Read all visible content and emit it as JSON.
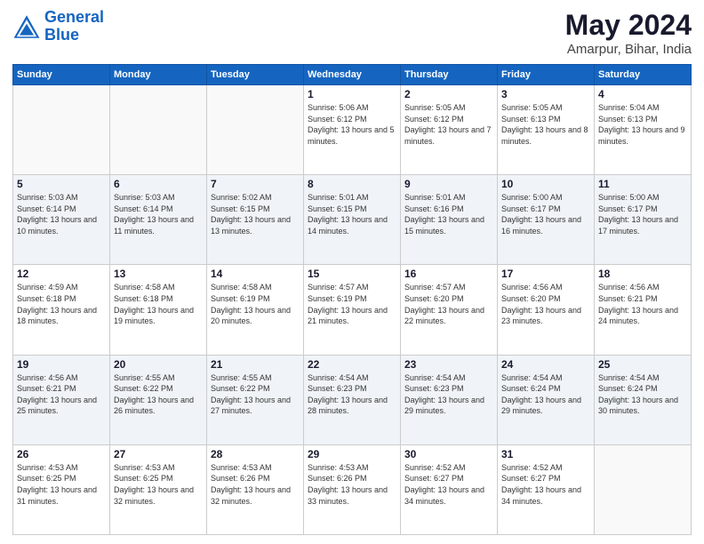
{
  "logo": {
    "line1": "General",
    "line2": "Blue"
  },
  "title": "May 2024",
  "subtitle": "Amarpur, Bihar, India",
  "weekdays": [
    "Sunday",
    "Monday",
    "Tuesday",
    "Wednesday",
    "Thursday",
    "Friday",
    "Saturday"
  ],
  "weeks": [
    [
      {
        "day": "",
        "info": ""
      },
      {
        "day": "",
        "info": ""
      },
      {
        "day": "",
        "info": ""
      },
      {
        "day": "1",
        "info": "Sunrise: 5:06 AM\nSunset: 6:12 PM\nDaylight: 13 hours\nand 5 minutes."
      },
      {
        "day": "2",
        "info": "Sunrise: 5:05 AM\nSunset: 6:12 PM\nDaylight: 13 hours\nand 7 minutes."
      },
      {
        "day": "3",
        "info": "Sunrise: 5:05 AM\nSunset: 6:13 PM\nDaylight: 13 hours\nand 8 minutes."
      },
      {
        "day": "4",
        "info": "Sunrise: 5:04 AM\nSunset: 6:13 PM\nDaylight: 13 hours\nand 9 minutes."
      }
    ],
    [
      {
        "day": "5",
        "info": "Sunrise: 5:03 AM\nSunset: 6:14 PM\nDaylight: 13 hours\nand 10 minutes."
      },
      {
        "day": "6",
        "info": "Sunrise: 5:03 AM\nSunset: 6:14 PM\nDaylight: 13 hours\nand 11 minutes."
      },
      {
        "day": "7",
        "info": "Sunrise: 5:02 AM\nSunset: 6:15 PM\nDaylight: 13 hours\nand 13 minutes."
      },
      {
        "day": "8",
        "info": "Sunrise: 5:01 AM\nSunset: 6:15 PM\nDaylight: 13 hours\nand 14 minutes."
      },
      {
        "day": "9",
        "info": "Sunrise: 5:01 AM\nSunset: 6:16 PM\nDaylight: 13 hours\nand 15 minutes."
      },
      {
        "day": "10",
        "info": "Sunrise: 5:00 AM\nSunset: 6:17 PM\nDaylight: 13 hours\nand 16 minutes."
      },
      {
        "day": "11",
        "info": "Sunrise: 5:00 AM\nSunset: 6:17 PM\nDaylight: 13 hours\nand 17 minutes."
      }
    ],
    [
      {
        "day": "12",
        "info": "Sunrise: 4:59 AM\nSunset: 6:18 PM\nDaylight: 13 hours\nand 18 minutes."
      },
      {
        "day": "13",
        "info": "Sunrise: 4:58 AM\nSunset: 6:18 PM\nDaylight: 13 hours\nand 19 minutes."
      },
      {
        "day": "14",
        "info": "Sunrise: 4:58 AM\nSunset: 6:19 PM\nDaylight: 13 hours\nand 20 minutes."
      },
      {
        "day": "15",
        "info": "Sunrise: 4:57 AM\nSunset: 6:19 PM\nDaylight: 13 hours\nand 21 minutes."
      },
      {
        "day": "16",
        "info": "Sunrise: 4:57 AM\nSunset: 6:20 PM\nDaylight: 13 hours\nand 22 minutes."
      },
      {
        "day": "17",
        "info": "Sunrise: 4:56 AM\nSunset: 6:20 PM\nDaylight: 13 hours\nand 23 minutes."
      },
      {
        "day": "18",
        "info": "Sunrise: 4:56 AM\nSunset: 6:21 PM\nDaylight: 13 hours\nand 24 minutes."
      }
    ],
    [
      {
        "day": "19",
        "info": "Sunrise: 4:56 AM\nSunset: 6:21 PM\nDaylight: 13 hours\nand 25 minutes."
      },
      {
        "day": "20",
        "info": "Sunrise: 4:55 AM\nSunset: 6:22 PM\nDaylight: 13 hours\nand 26 minutes."
      },
      {
        "day": "21",
        "info": "Sunrise: 4:55 AM\nSunset: 6:22 PM\nDaylight: 13 hours\nand 27 minutes."
      },
      {
        "day": "22",
        "info": "Sunrise: 4:54 AM\nSunset: 6:23 PM\nDaylight: 13 hours\nand 28 minutes."
      },
      {
        "day": "23",
        "info": "Sunrise: 4:54 AM\nSunset: 6:23 PM\nDaylight: 13 hours\nand 29 minutes."
      },
      {
        "day": "24",
        "info": "Sunrise: 4:54 AM\nSunset: 6:24 PM\nDaylight: 13 hours\nand 29 minutes."
      },
      {
        "day": "25",
        "info": "Sunrise: 4:54 AM\nSunset: 6:24 PM\nDaylight: 13 hours\nand 30 minutes."
      }
    ],
    [
      {
        "day": "26",
        "info": "Sunrise: 4:53 AM\nSunset: 6:25 PM\nDaylight: 13 hours\nand 31 minutes."
      },
      {
        "day": "27",
        "info": "Sunrise: 4:53 AM\nSunset: 6:25 PM\nDaylight: 13 hours\nand 32 minutes."
      },
      {
        "day": "28",
        "info": "Sunrise: 4:53 AM\nSunset: 6:26 PM\nDaylight: 13 hours\nand 32 minutes."
      },
      {
        "day": "29",
        "info": "Sunrise: 4:53 AM\nSunset: 6:26 PM\nDaylight: 13 hours\nand 33 minutes."
      },
      {
        "day": "30",
        "info": "Sunrise: 4:52 AM\nSunset: 6:27 PM\nDaylight: 13 hours\nand 34 minutes."
      },
      {
        "day": "31",
        "info": "Sunrise: 4:52 AM\nSunset: 6:27 PM\nDaylight: 13 hours\nand 34 minutes."
      },
      {
        "day": "",
        "info": ""
      }
    ]
  ]
}
